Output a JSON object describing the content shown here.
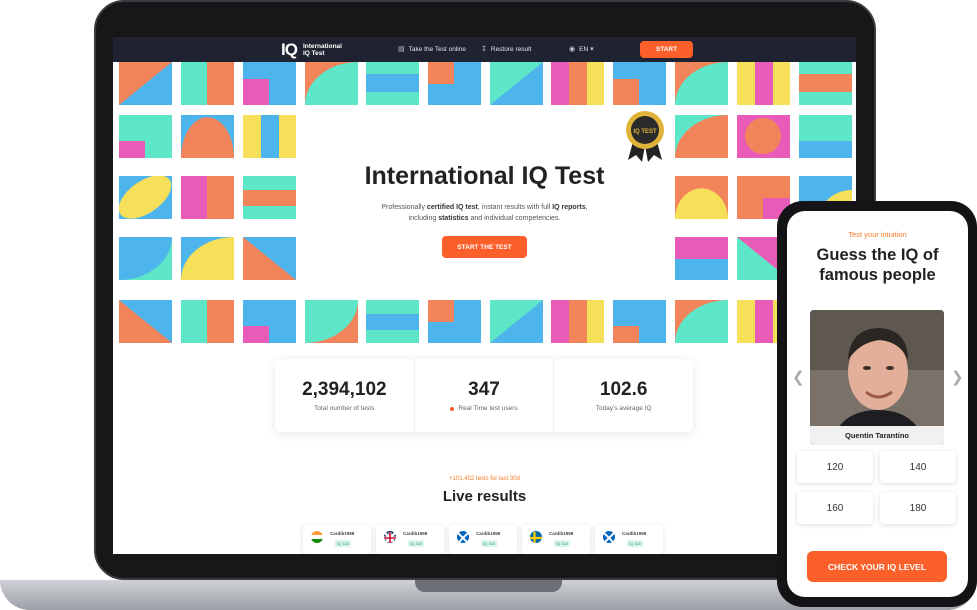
{
  "colors": {
    "accent": "#fb5f2a",
    "nav_bg": "#1f2230",
    "tile_orange": "#f2845c",
    "tile_blue": "#4db4ec",
    "tile_mint": "#5ee6c8",
    "tile_pink": "#e85cb8",
    "tile_yellow": "#f6e05a"
  },
  "nav": {
    "logo_mark": "IQ",
    "logo_text": "International IQ Test",
    "take_test": "Take the Test online",
    "restore": "Restore result",
    "language": "EN",
    "start": "START"
  },
  "hero": {
    "badge": "IQ TEST",
    "title": "International IQ Test",
    "subtitle_line1_pre": "Professionally ",
    "subtitle_line1_b1": "certified IQ test",
    "subtitle_line1_mid": ", instant results with full ",
    "subtitle_line1_b2": "IQ reports",
    "subtitle_line1_post": ",",
    "subtitle_line2_pre": "including ",
    "subtitle_line2_b": "statistics",
    "subtitle_line2_post": " and individual competencies.",
    "cta": "START THE TEST"
  },
  "stats": [
    {
      "value": "2,394,102",
      "label": "Total number of tests"
    },
    {
      "value": "347",
      "label": "Real Time test users"
    },
    {
      "value": "102.6",
      "label": "Today's average IQ"
    }
  ],
  "live": {
    "subtitle": "+101,452 tests for last 30d",
    "title": "Live results",
    "cards": [
      {
        "name": "Cardib1998",
        "iq": "IQ 118",
        "flag": "india-flag-icon"
      },
      {
        "name": "Cardib1998",
        "iq": "IQ 118",
        "flag": "uk-flag-icon"
      },
      {
        "name": "Cardib1998",
        "iq": "IQ 118",
        "flag": "scotland-flag-icon"
      },
      {
        "name": "Cardib1998",
        "iq": "IQ 118",
        "flag": "sweden-flag-icon"
      },
      {
        "name": "Cardib1998",
        "iq": "IQ 118",
        "flag": "scotland-flag-icon"
      }
    ]
  },
  "phone": {
    "kicker": "Test your intuition",
    "title_line1": "Guess the IQ of",
    "title_line2": "famous people",
    "person": "Quentin Tarantino",
    "options": [
      "120",
      "140",
      "160",
      "180"
    ],
    "cta": "CHECK YOUR IQ LEVEL"
  }
}
